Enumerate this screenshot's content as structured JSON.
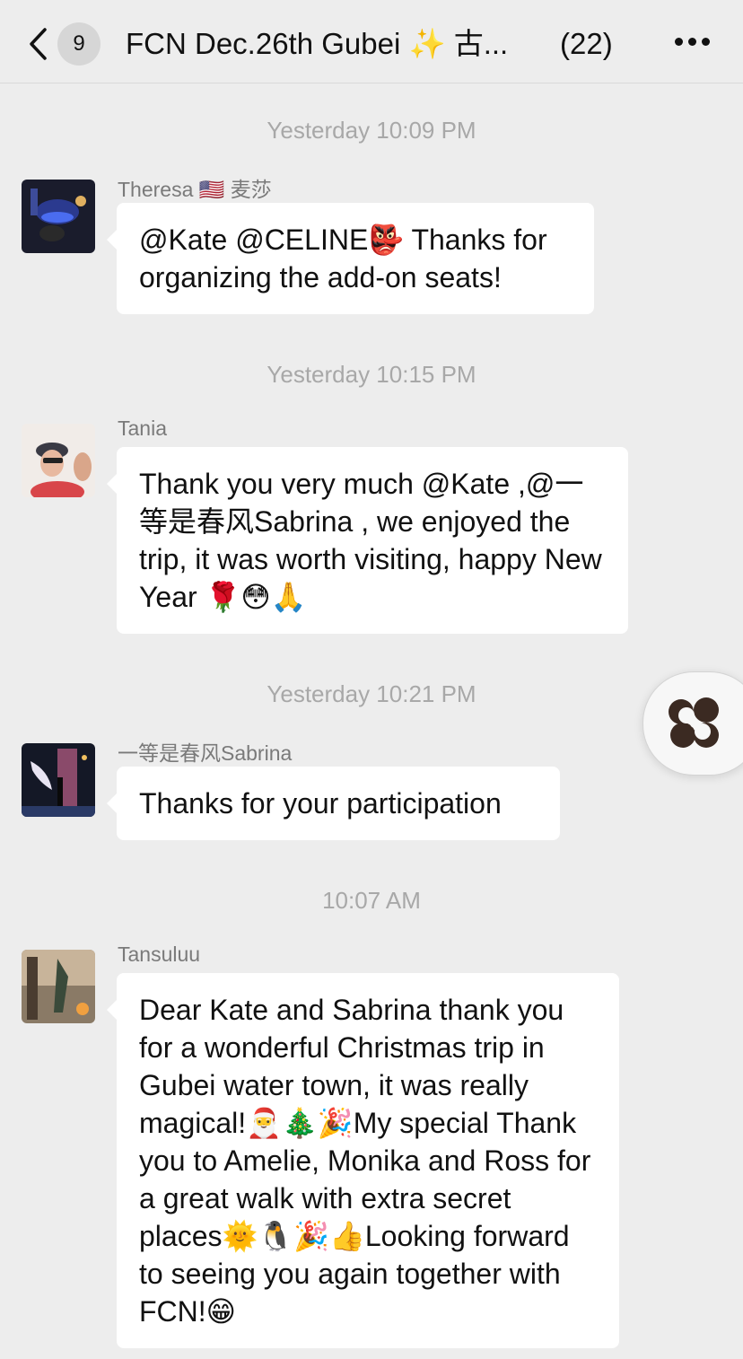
{
  "header": {
    "unread_count": "9",
    "title": "FCN Dec.26th Gubei ✨ 古...",
    "member_count": "(22)"
  },
  "messages": [
    {
      "timestamp": "Yesterday 10:09 PM",
      "sender": "Theresa 🇺🇸 麦莎",
      "text": "@Kate @CELINE👺  Thanks for organizing the add-on seats!"
    },
    {
      "timestamp": "Yesterday 10:15 PM",
      "sender": "Tania",
      "text": "Thank you very much @Kate ,@一等是春风Sabrina , we enjoyed the trip, it was worth visiting, happy New Year 🌹😳🙏"
    },
    {
      "timestamp": "Yesterday 10:21 PM",
      "sender": "一等是春风Sabrina",
      "text": "Thanks for your participation"
    },
    {
      "timestamp": "10:07 AM",
      "sender": "Tansuluu",
      "text": "Dear Kate and Sabrina thank you for a wonderful Christmas trip in Gubei water town, it was really magical!🎅🎄🎉My special Thank you to Amelie, Monika and Ross for a great walk with extra secret places🌞🐧🎉👍Looking forward to seeing you again together with FCN!😁"
    }
  ],
  "icons": {
    "back": "chevron-left-icon",
    "more": "more-icon",
    "floating": "floating-window-icon"
  },
  "colors": {
    "background": "#ededed",
    "bubble": "#ffffff",
    "timestamp": "#a8a8a8",
    "sender": "#7a7a7a"
  }
}
